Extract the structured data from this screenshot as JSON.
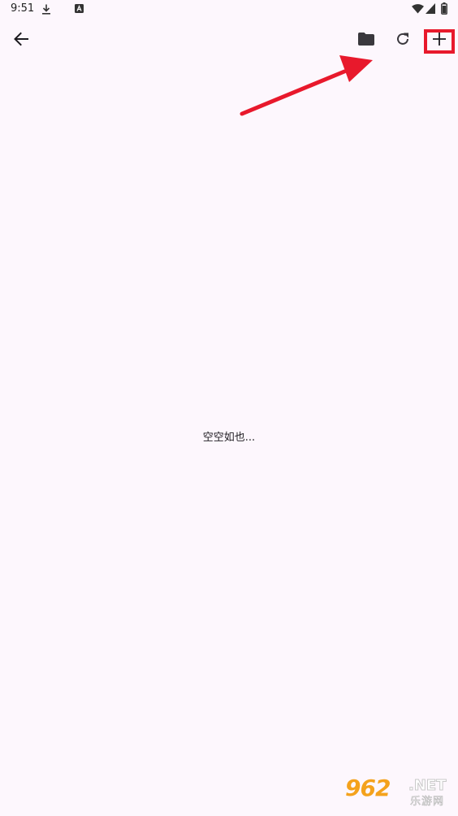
{
  "status_bar": {
    "time": "9:51",
    "left_icons": [
      "download-icon",
      "app-notification-icon"
    ],
    "right_icons": [
      "wifi-icon",
      "signal-icon",
      "battery-icon"
    ]
  },
  "app_bar": {
    "back_icon": "arrow-back-icon",
    "actions": [
      "folder-icon",
      "refresh-icon",
      "add-icon"
    ]
  },
  "empty_state": {
    "message": "空空如也..."
  },
  "annotation": {
    "color": "#e8192c",
    "highlighted": "add-button"
  },
  "watermark": {
    "brand": "962",
    "domain": ".NET",
    "subtitle": "乐游网"
  },
  "colors": {
    "background": "#fdf7fd",
    "icon": "#1d1b20",
    "annotation_red": "#e8192c",
    "watermark_orange": "#f4a21c"
  }
}
